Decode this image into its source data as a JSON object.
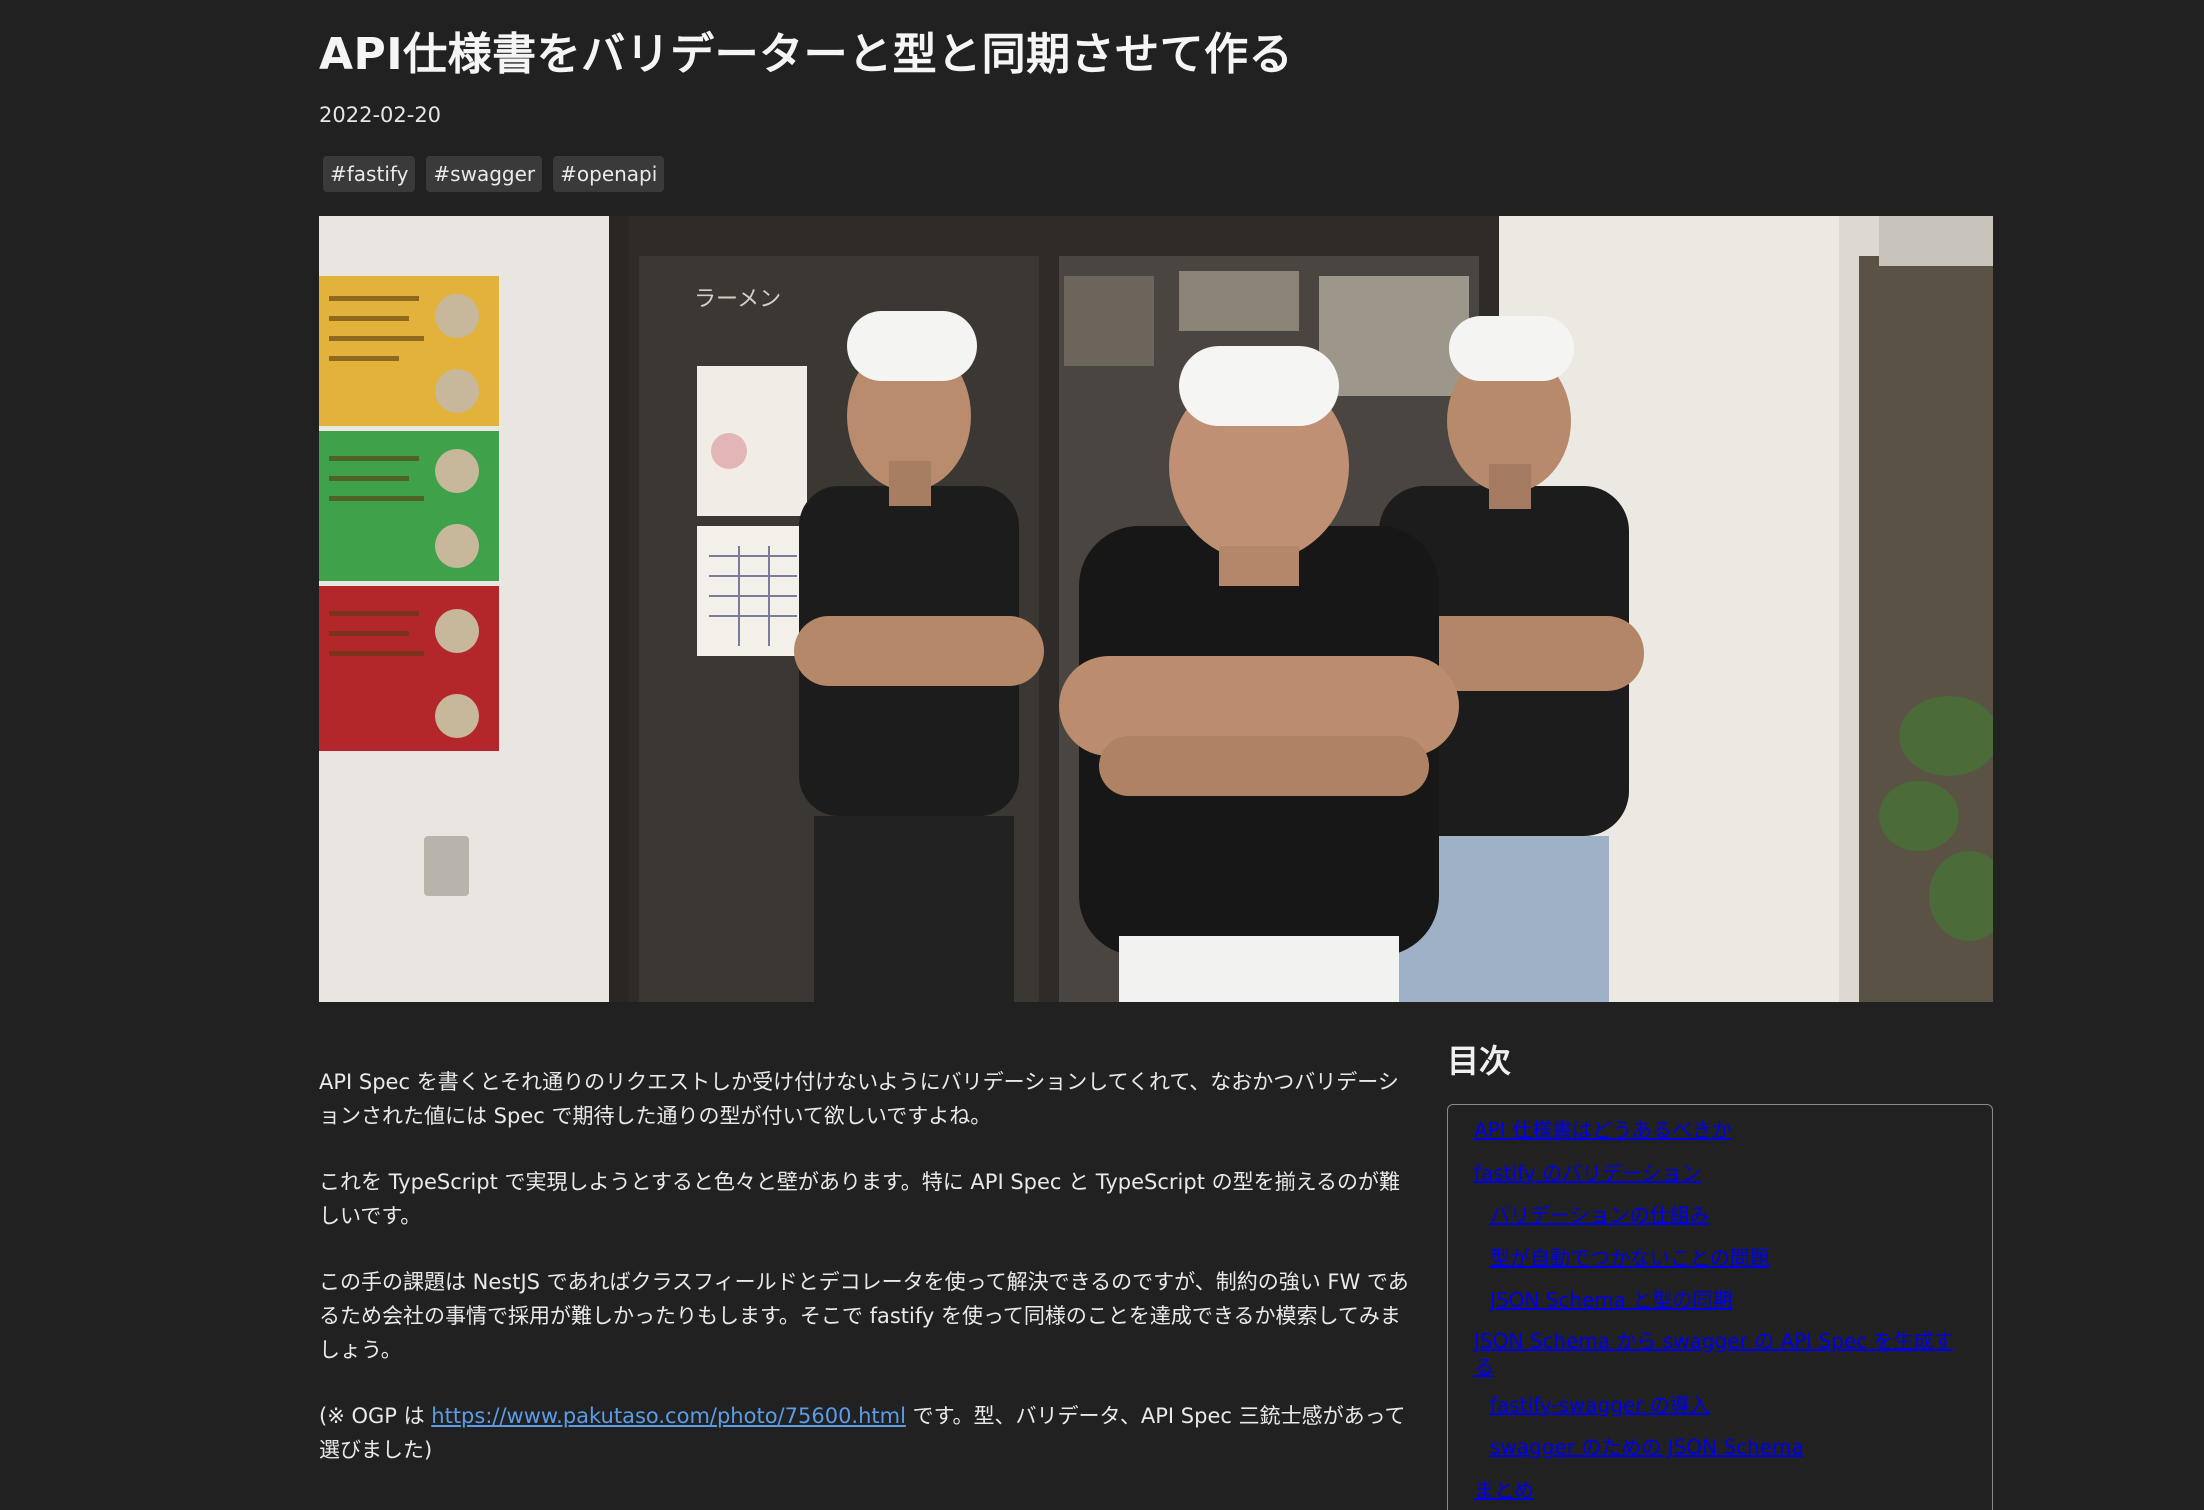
{
  "article": {
    "title": "API仕様書をバリデーターと型と同期させて作る",
    "date": "2022-02-20",
    "tags": [
      "#fastify",
      "#swagger",
      "#openapi"
    ]
  },
  "hero_image": {
    "sign_text": "ラーメン"
  },
  "body": {
    "p1": "API Spec を書くとそれ通りのリクエストしか受け付けないようにバリデーションしてくれて、なおかつバリデーションされた値には Spec で期待した通りの型が付いて欲しいですよね。",
    "p2": "これを TypeScript で実現しようとすると色々と壁があります。特に API Spec と TypeScript の型を揃えるのが難しいです。",
    "p3": "この手の課題は NestJS であればクラスフィールドとデコレータを使って解決できるのですが、制約の強い FW であるため会社の事情で採用が難しかったりもします。そこで fastify を使って同様のことを達成できるか模索してみましょう。",
    "p4_prefix": "(※ OGP は ",
    "p4_link": "https://www.pakutaso.com/photo/75600.html",
    "p4_suffix": " です。型、バリデータ、API Spec 三銃士感があって選びました)"
  },
  "toc": {
    "heading": "目次",
    "items": [
      {
        "label": "API 仕様書はどうあるべきか",
        "level": 1
      },
      {
        "label": "fastify のバリデーション",
        "level": 1
      },
      {
        "label": "バリデーションの仕組み",
        "level": 2
      },
      {
        "label": "型が自動でつかないことの問題",
        "level": 2
      },
      {
        "label": "JSON Schema と型の同期",
        "level": 2
      },
      {
        "label": "JSON Schema から swagger の API Spec を生成する",
        "level": 1
      },
      {
        "label": "fastify-swagger の導入",
        "level": 2
      },
      {
        "label": "swagger のための JSON Schema",
        "level": 2
      },
      {
        "label": "まとめ",
        "level": 1
      }
    ]
  }
}
